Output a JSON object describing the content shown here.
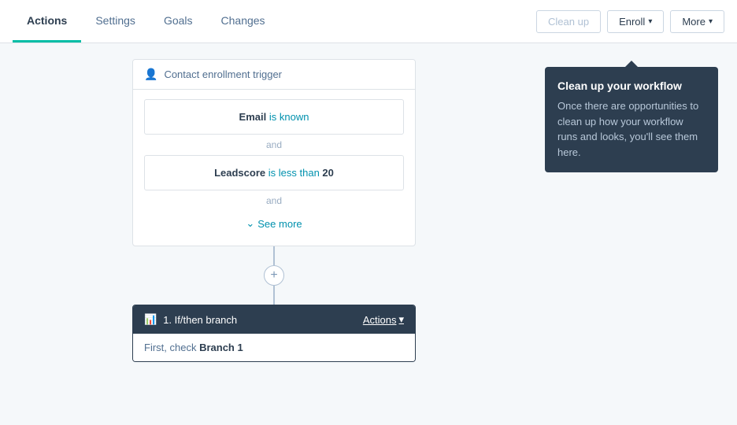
{
  "nav": {
    "tabs": [
      {
        "label": "Actions",
        "active": true
      },
      {
        "label": "Settings",
        "active": false
      },
      {
        "label": "Goals",
        "active": false
      },
      {
        "label": "Changes",
        "active": false
      }
    ],
    "buttons": {
      "cleanup_label": "Clean up",
      "enroll_label": "Enroll",
      "more_label": "More"
    }
  },
  "trigger_card": {
    "header": "Contact enrollment trigger",
    "conditions": [
      {
        "field": "Email",
        "operator": "is known",
        "value": ""
      },
      {
        "field": "Leadscore",
        "operator": "is less than",
        "value": "20"
      }
    ],
    "and_label": "and",
    "see_more_label": "See more"
  },
  "connector": {
    "plus_symbol": "+"
  },
  "branch_card": {
    "title": "1. If/then branch",
    "actions_label": "Actions",
    "body_text": "First, check ",
    "body_bold": "Branch 1"
  },
  "tooltip": {
    "title": "Clean up your workflow",
    "body": "Once there are opportunities to clean up how your workflow runs and looks, you'll see them here."
  }
}
